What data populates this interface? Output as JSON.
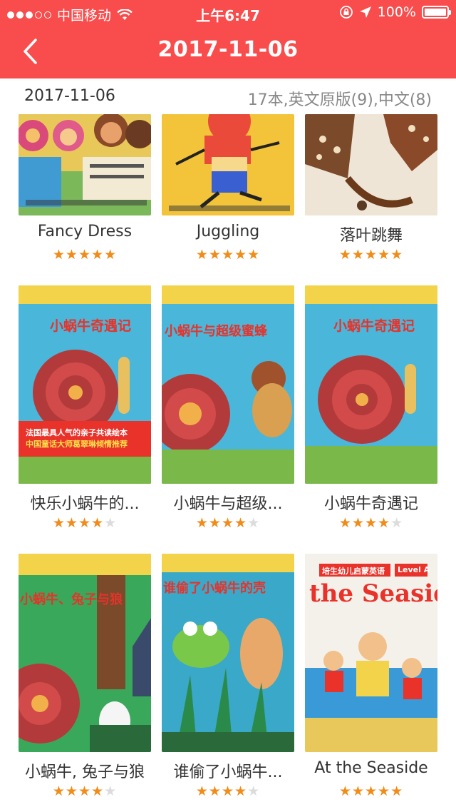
{
  "status_bar": {
    "carrier": "中国移动",
    "time": "上午6:47",
    "battery": "100%"
  },
  "nav": {
    "title": "2017-11-06"
  },
  "subhead": {
    "date": "2017-11-06",
    "summary": "17本,英文原版(9),中文(8)"
  },
  "colors": {
    "header": "#f94c4c",
    "star": "#f08c1a"
  },
  "books": [
    {
      "title": "Fancy Dress",
      "rating": 5
    },
    {
      "title": "Juggling",
      "rating": 5
    },
    {
      "title": "落叶跳舞",
      "rating": 5
    },
    {
      "title": "快乐小蜗牛的...",
      "rating": 4
    },
    {
      "title": "小蜗牛与超级...",
      "rating": 4
    },
    {
      "title": "小蜗牛奇遇记",
      "rating": 4
    },
    {
      "title": "小蜗牛, 兔子与狼",
      "rating": 4
    },
    {
      "title": "谁偷了小蜗牛...",
      "rating": 4
    },
    {
      "title": "At the Seaside",
      "rating": 5
    }
  ],
  "cover_text": {
    "book4_title": "小蜗牛奇遇记",
    "book4_red_1": "法国最具人气的亲子共读绘本",
    "book4_red_2": "中国童话大师葛翠琳倾情推荐",
    "book5_title": "小蜗牛与超级蜜蜂",
    "book6_title": "小蜗牛奇遇记",
    "book7_title": "小蜗牛、兔子与狼",
    "book8_title": "谁偷了小蜗牛的壳",
    "book9_series": "培生幼儿启蒙英语",
    "book9_level": "Level A",
    "book9_title": "the Seaside"
  }
}
